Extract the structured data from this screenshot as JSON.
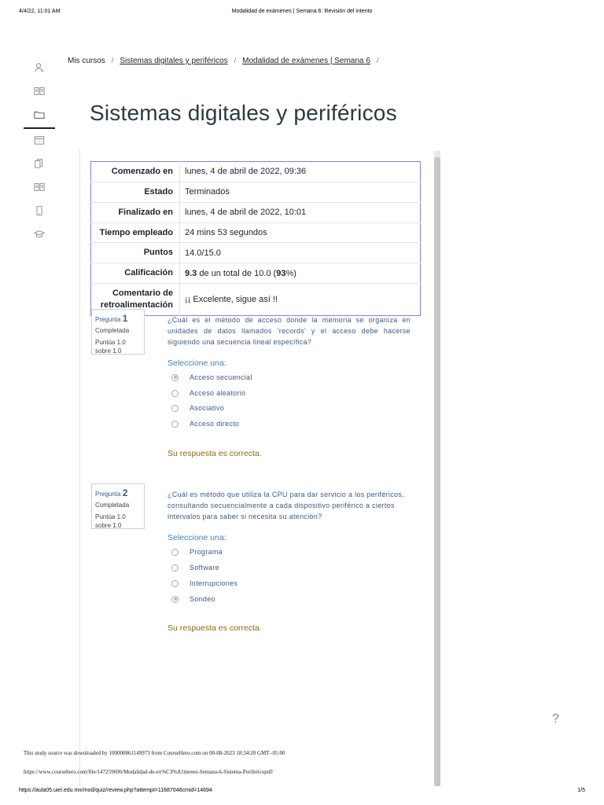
{
  "print_header": {
    "date": "4/4/22, 11:01 AM",
    "title": "Modalidad de exámenes | Semana 6: Revisión del intento"
  },
  "sidebar": {
    "icons": [
      "user-icon",
      "book-icon",
      "folder-icon",
      "calendar-icon",
      "copy-icon",
      "library-icon",
      "mobile-icon",
      "graduation-cap-icon"
    ]
  },
  "breadcrumb": {
    "items": [
      "Mis cursos",
      "Sistemas digitales y periféricos",
      "Modalidad de exámenes | Semana 6"
    ],
    "separator": "/"
  },
  "page_title": "Sistemas digitales y periféricos",
  "summary": {
    "started_label": "Comenzado en",
    "started_value": "lunes, 4 de abril de 2022, 09:36",
    "state_label": "Estado",
    "state_value": "Terminados",
    "finished_label": "Finalizado en",
    "finished_value": "lunes, 4 de abril de 2022, 10:01",
    "time_label": "Tiempo empleado",
    "time_value": "24 mins 53 segundos",
    "points_label": "Puntos",
    "points_value": "14.0/15.0",
    "grade_label": "Calificación",
    "grade_bold": "9.3",
    "grade_middle": " de un total de 10.0 (",
    "grade_pct": "93",
    "grade_end": "%)",
    "feedback_label": "Comentario de retroalimentación",
    "feedback_value": "¡¡ Excelente, sigue así !!"
  },
  "questions": [
    {
      "label": "Pregunta",
      "number": "1",
      "state": "Completada",
      "grade": "Puntúa 1.0 sobre 1.0",
      "text": "¿Cuál es el método de acceso donde la memoria se organiza en unidades de datos llamados ‘records’ y el acceso debe hacerse siguiendo una secuencia lineal específica?",
      "prompt": "Seleccione una:",
      "options": [
        "Acceso secuencial",
        "Acceso aleatorio",
        "Asociativo",
        "Acceso directo"
      ],
      "selected_index": 0,
      "feedback": "Su respuesta es correcta."
    },
    {
      "label": "Pregunta",
      "number": "2",
      "state": "Completada",
      "grade": "Puntúa 1.0 sobre 1.0",
      "text": "¿Cuál es método que utiliza la CPU para dar servicio a los periféricos, consultando secuencialmente a cada dispositivo periférico a ciertos intervalos para saber si necesita su atención?",
      "prompt": "Seleccione una:",
      "options": [
        "Programa",
        "Software",
        "Interrupciones",
        "Sondeo"
      ],
      "selected_index": 3,
      "feedback": "Su respuesta es correcta."
    }
  ],
  "help_label": "?",
  "footer": {
    "source": "This study source was downloaded by 100000861149973 from CourseHero.com on 08-08-2023 18:34:20 GMT -05:00",
    "url": "https://www.coursehero.com/file/147259696/Modalidad-de-ex%C3%A1menes-Semana-6-Sistema-Perifericopdf/"
  },
  "print_footer": {
    "url": "https://aula05.uiel.edu.mx/mod/quiz/review.php?attempt=11687046cmid=14694",
    "page": "1/5"
  },
  "colors": {
    "accent": "#8b7fd6",
    "link": "#3c5a80",
    "prompt": "#4a7fb3",
    "feedback": "#8c6a14"
  }
}
